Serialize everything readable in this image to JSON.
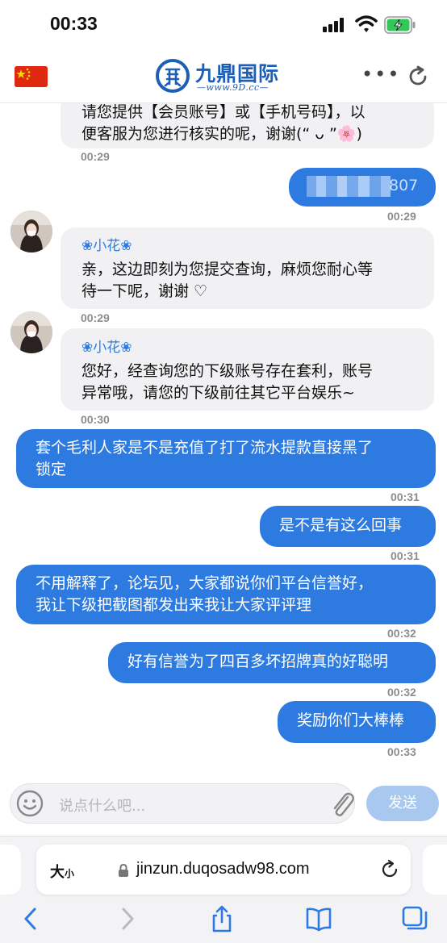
{
  "status_bar": {
    "time": "00:33"
  },
  "header": {
    "logo_title": "九鼎国际",
    "logo_subtitle": "—www.9D.cc—",
    "more_label": "•••"
  },
  "chat": {
    "partial_top_message": {
      "line1": "请您提供【会员账号】或【手机号码】，以",
      "line2": "便客服为您进行核实的呢，谢谢(“ ᴗ ”🌸)",
      "time": "00:29"
    },
    "redacted_user_message": {
      "visible_tail": "807",
      "time": "00:29"
    },
    "agent_messages": [
      {
        "name": "❀小花❀",
        "line1": "亲，这边即刻为您提交查询，麻烦您耐心等",
        "line2": "待一下呢，谢谢 ♡",
        "time": "00:29"
      },
      {
        "name": "❀小花❀",
        "line1": "您好，经查询您的下级账号存在套利，账号",
        "line2": "异常哦，请您的下级前往其它平台娱乐~",
        "time": "00:30"
      }
    ],
    "user_messages": [
      {
        "line1": "套个毛利人家是不是充值了打了流水提款直接黑了",
        "line2": "锁定",
        "time": "00:31"
      },
      {
        "line1": "是不是有这么回事",
        "time": "00:31"
      },
      {
        "line1": "不用解释了，论坛见，大家都说你们平台信誉好，",
        "line2": "我让下级把截图都发出来我让大家评评理",
        "time": "00:32"
      },
      {
        "line1": "好有信誉为了四百多坏招牌真的好聪明",
        "time": "00:32"
      },
      {
        "line1": "奖励你们大棒棒",
        "time": "00:33"
      }
    ]
  },
  "input": {
    "placeholder": "说点什么吧...",
    "send_label": "发送"
  },
  "browser": {
    "text_size_label": "大",
    "text_size_small": "小",
    "url": "jinzun.duqosadw98.com"
  },
  "colors": {
    "accent": "#2d7be1",
    "send_disabled": "#a9c8ef",
    "agent_bubble": "#f1f1f3",
    "flag_red": "#de2910",
    "flag_star": "#ffde00",
    "battery_green": "#34c759"
  },
  "icons": [
    "china-flag-icon",
    "logo-icon",
    "more-icon",
    "refresh-icon",
    "emoji-icon",
    "paperclip-icon",
    "lock-icon",
    "reload-icon",
    "back-icon",
    "forward-icon",
    "share-icon",
    "bookmarks-icon",
    "tabs-icon"
  ]
}
